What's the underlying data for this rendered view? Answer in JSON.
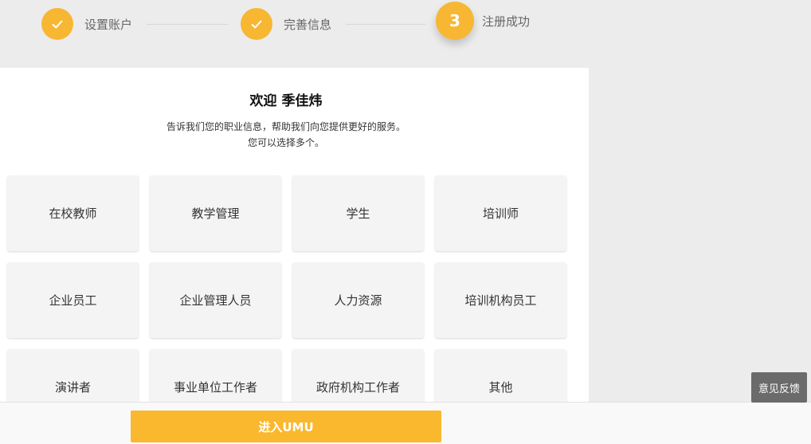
{
  "stepper": {
    "steps": [
      {
        "label": "设置账户",
        "status": "done",
        "icon": "check-icon"
      },
      {
        "label": "完善信息",
        "status": "done",
        "icon": "check-icon"
      },
      {
        "label": "注册成功",
        "status": "current",
        "number": "3"
      }
    ],
    "accent_color": "#f7b733"
  },
  "card": {
    "title": "欢迎 季佳炜",
    "subtitle_line1": "告诉我们您的职业信息，帮助我们向您提供更好的服务。",
    "subtitle_line2": "您可以选择多个。",
    "roles": [
      "在校教师",
      "教学管理",
      "学生",
      "培训师",
      "企业员工",
      "企业管理人员",
      "人力资源",
      "培训机构员工",
      "演讲者",
      "事业单位工作者",
      "政府机构工作者",
      "其他"
    ]
  },
  "footer": {
    "enter_button": "进入UMU"
  },
  "feedback": {
    "label": "意见反馈"
  }
}
